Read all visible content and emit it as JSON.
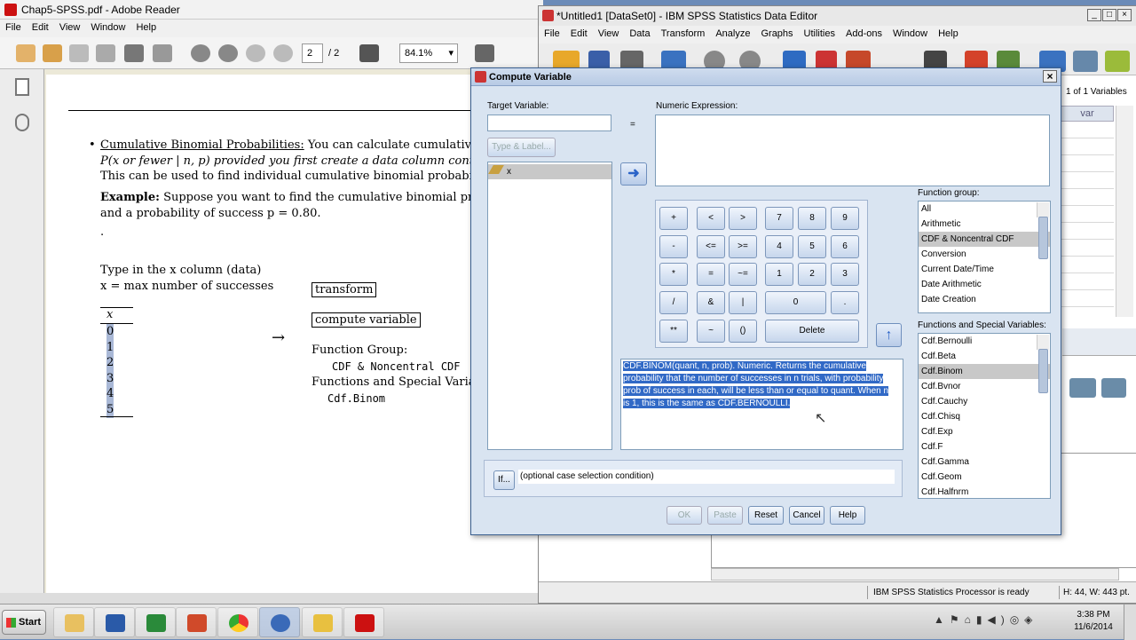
{
  "reader": {
    "title": "Chap5-SPSS.pdf - Adobe Reader",
    "menu": [
      "File",
      "Edit",
      "View",
      "Window",
      "Help"
    ],
    "page_input": "2",
    "page_total": "/ 2",
    "zoom": "84.1%",
    "content": {
      "bullet_heading": "Cumulative Binomial Probabilities:",
      "bullet_text1": "You can calculate cumulative bi",
      "line2": "P(x or fewer | n, p) provided you first create a data column containi",
      "line3": "This can be used to find individual cumulative binomial probabilitie",
      "example_label": "Example:",
      "example_text": "Suppose you want to find the cumulative binomial proba",
      "line5": "and a probability of success p = 0.80.",
      "dot": ".",
      "type_line": "Type in the x column (data)",
      "max_line": "x = max number of successes",
      "column_header": "x",
      "column_values": [
        "0",
        "1",
        "2",
        "3",
        "4",
        "5"
      ],
      "arrow": "→",
      "transform": "transform",
      "compute_variable": "compute variable",
      "function_group_label": "Function Group:",
      "function_group_value": "CDF & Noncentral CDF",
      "functions_label": "Functions and Special Variable",
      "functions_value": "Cdf.Binom"
    }
  },
  "spss": {
    "title": "*Untitled1 [DataSet0] - IBM SPSS Statistics Data Editor",
    "menu": [
      "File",
      "Edit",
      "View",
      "Data",
      "Transform",
      "Analyze",
      "Graphs",
      "Utilities",
      "Add-ons",
      "Window",
      "Help"
    ],
    "var_count": "1 of 1 Variables",
    "col_header": "var",
    "status": "IBM SPSS Statistics Processor is ready",
    "dims": "H: 44, W: 443 pt."
  },
  "dialog": {
    "title": "Compute Variable",
    "close": "×",
    "target_label": "Target Variable:",
    "target_value": "",
    "equals": "=",
    "expr_label": "Numeric Expression:",
    "type_label_btn": "Type & Label...",
    "variables": [
      "x"
    ],
    "keypad": [
      "+",
      "<",
      ">",
      "7",
      "8",
      "9",
      "-",
      "<=",
      ">=",
      "4",
      "5",
      "6",
      "*",
      "=",
      "~=",
      "1",
      "2",
      "3",
      "/",
      "&",
      "|",
      "0",
      ".",
      "**",
      "~",
      "()",
      "Delete"
    ],
    "description": "CDF.BINOM(quant, n, prob). Numeric. Returns the cumulative probability that the number of successes in n trials, with probability prob of success in each, will be less than or equal to quant. When n is 1, this is the same as CDF.BERNOULLI.",
    "function_group_label": "Function group:",
    "function_groups": [
      "All",
      "Arithmetic",
      "CDF & Noncentral CDF",
      "Conversion",
      "Current Date/Time",
      "Date Arithmetic",
      "Date Creation"
    ],
    "function_group_selected": "CDF & Noncentral CDF",
    "functions_label": "Functions and Special Variables:",
    "functions": [
      "Cdf.Bernoulli",
      "Cdf.Beta",
      "Cdf.Binom",
      "Cdf.Bvnor",
      "Cdf.Cauchy",
      "Cdf.Chisq",
      "Cdf.Exp",
      "Cdf.F",
      "Cdf.Gamma",
      "Cdf.Geom",
      "Cdf.Halfnrm"
    ],
    "function_selected": "Cdf.Binom",
    "if_btn": "If...",
    "if_text": "(optional case selection condition)",
    "ok": "OK",
    "paste": "Paste",
    "reset": "Reset",
    "cancel": "Cancel",
    "help": "Help"
  },
  "taskbar": {
    "start": "Start",
    "time": "3:38 PM",
    "date": "11/6/2014"
  },
  "colors": {
    "highlight": "#3169c6",
    "dialog_bg": "#d9e4f1",
    "arrow_blue": "#2a63c8"
  }
}
